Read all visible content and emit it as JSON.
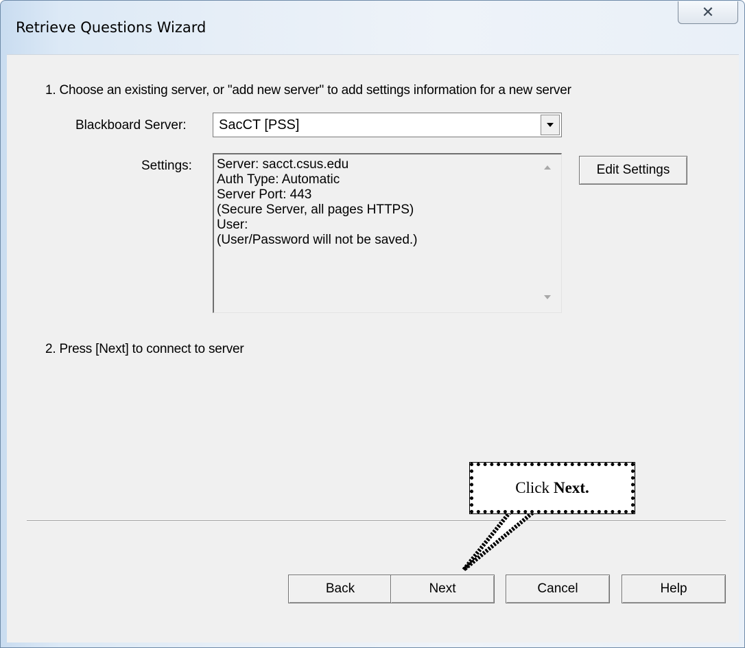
{
  "window": {
    "title": "Retrieve Questions Wizard",
    "close_glyph": "✕"
  },
  "step1": {
    "text": "1.  Choose an existing server, or \"add new server\" to add settings information for a new server",
    "server_label": "Blackboard Server:",
    "server_value": "SacCT [PSS]",
    "settings_label": "Settings:",
    "settings_lines": [
      "Server: sacct.csus.edu",
      "Auth Type: Automatic",
      "Server Port: 443",
      "(Secure Server, all pages HTTPS)",
      "User:",
      "(User/Password will not be saved.)"
    ],
    "edit_settings_label": "Edit Settings"
  },
  "step2": {
    "text": "2.  Press [Next] to connect to server"
  },
  "buttons": {
    "back": "Back",
    "next": "Next",
    "cancel": "Cancel",
    "help": "Help"
  },
  "callout": {
    "prefix": "Click",
    "emphasis": "Next."
  },
  "icons": {
    "dropdown": "chevron-down-icon",
    "close": "close-icon",
    "scroll_up": "scroll-up-arrow-icon",
    "scroll_down": "scroll-down-arrow-icon"
  }
}
